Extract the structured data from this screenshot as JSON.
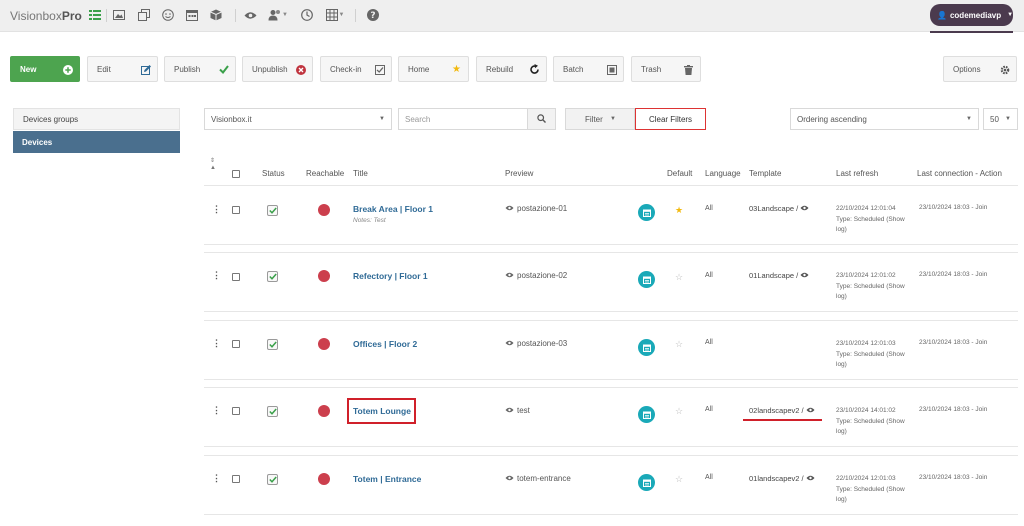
{
  "brand": {
    "name": "Visionbox",
    "suffix": "Pro"
  },
  "top_icons": [
    "list-icon",
    "image-icon",
    "pages-icon",
    "smiley-icon",
    "calendar-icon",
    "box-icon",
    "eye-icon",
    "users-icon",
    "clock-icon",
    "grid-icon",
    "help-icon"
  ],
  "user": {
    "name": "codemediavp"
  },
  "toolbar": {
    "new": "New",
    "edit": "Edit",
    "publish": "Publish",
    "unpublish": "Unpublish",
    "checkin": "Check-in",
    "home": "Home",
    "rebuild": "Rebuild",
    "batch": "Batch",
    "trash": "Trash",
    "options": "Options"
  },
  "sidebar": {
    "items": [
      {
        "label": "Devices groups"
      },
      {
        "label": "Devices"
      }
    ]
  },
  "filters": {
    "site": "Visionbox.it",
    "search_placeholder": "Search",
    "filter": "Filter",
    "clear": "Clear Filters",
    "ordering": "Ordering ascending",
    "limit": "50"
  },
  "table": {
    "headers": {
      "status": "Status",
      "reachable": "Reachable",
      "title": "Title",
      "preview": "Preview",
      "default": "Default",
      "language": "Language",
      "template": "Template",
      "last_refresh": "Last refresh",
      "last_connection": "Last connection - Action"
    },
    "rows": [
      {
        "title": "Break Area | Floor 1",
        "notes": "Notes: Test",
        "preview": "postazione-01",
        "default": true,
        "language": "All",
        "template": "03Landscape /",
        "refresh_date": "22/10/2024 12:01:04",
        "refresh_type": "Type: Scheduled (Show log)",
        "connection": "23/10/2024 18:03 - Join"
      },
      {
        "title": "Refectory | Floor 1",
        "notes": "",
        "preview": "postazione-02",
        "default": false,
        "language": "All",
        "template": "01Landscape /",
        "refresh_date": "23/10/2024 12:01:02",
        "refresh_type": "Type: Scheduled (Show log)",
        "connection": "23/10/2024 18:03 - Join"
      },
      {
        "title": "Offices | Floor 2",
        "notes": "",
        "preview": "postazione-03",
        "default": false,
        "language": "All",
        "template": "",
        "refresh_date": "23/10/2024 12:01:03",
        "refresh_type": "Type: Scheduled (Show log)",
        "connection": "23/10/2024 18:03 - Join"
      },
      {
        "title": "Totem Lounge",
        "notes": "",
        "preview": "test",
        "default": false,
        "language": "All",
        "template": "02landscapev2 /",
        "refresh_date": "23/10/2024 14:01:02",
        "refresh_type": "Type: Scheduled (Show log)",
        "connection": "23/10/2024 18:03 - Join"
      },
      {
        "title": "Totem | Entrance",
        "notes": "",
        "preview": "totem-entrance",
        "default": false,
        "language": "All",
        "template": "01landscapev2 /",
        "refresh_date": "22/10/2024 12:01:03",
        "refresh_type": "Type: Scheduled (Show log)",
        "connection": "23/10/2024 18:03 - Join"
      }
    ]
  },
  "colors": {
    "accent_green": "#4da44f",
    "sidebar_active": "#4a6f8e",
    "title_link": "#2f6a96",
    "reachable_dot": "#cc3f4d",
    "calendar_badge": "#1aa9b8",
    "highlight": "#d0202a",
    "user_button": "#4b3a4e"
  }
}
